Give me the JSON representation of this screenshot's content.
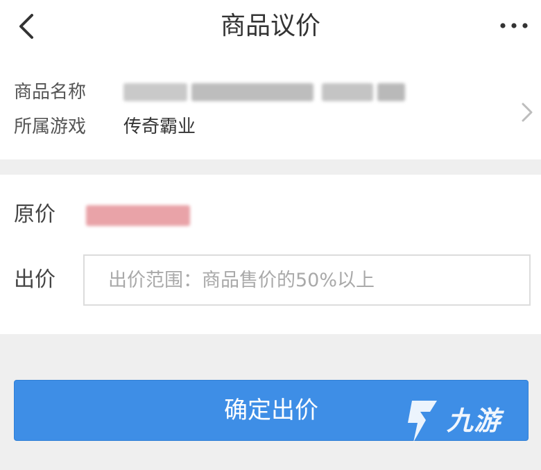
{
  "header": {
    "title": "商品议价",
    "back_icon": "chevron-left-icon",
    "more_icon": "more-horizontal-icon"
  },
  "product": {
    "name_label": "商品名称",
    "game_label": "所属游戏",
    "game_value": "传奇霸业",
    "arrow_icon": "chevron-right-icon"
  },
  "price": {
    "original_label": "原价",
    "offer_label": "出价",
    "offer_placeholder": "出价范围：商品售价的50%以上",
    "offer_value": ""
  },
  "actions": {
    "confirm_label": "确定出价"
  },
  "watermark": {
    "text": "九游"
  },
  "colors": {
    "primary": "#3e8ee6",
    "background": "#efefef",
    "card": "#ffffff",
    "price_blur": "#e9a3a8"
  }
}
